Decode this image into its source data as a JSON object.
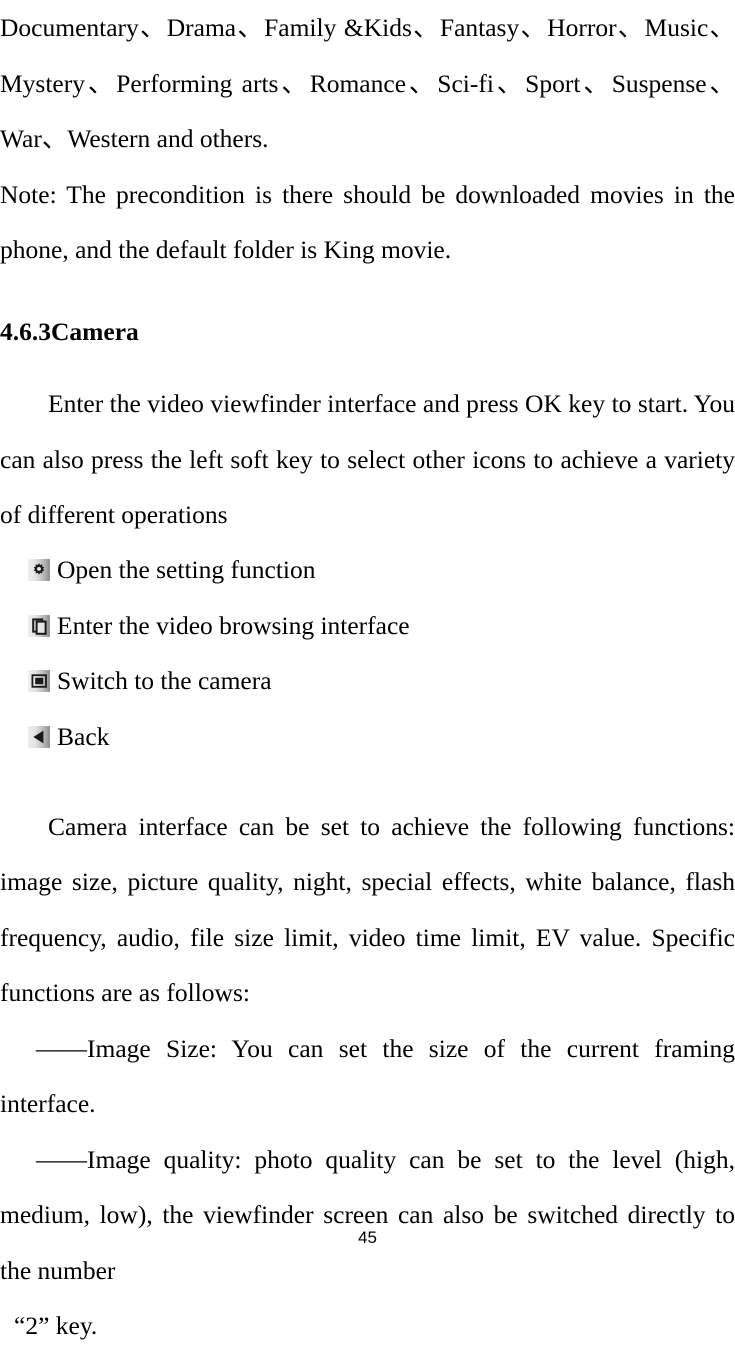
{
  "document": {
    "page_number": "45",
    "paragraphs": {
      "genres_continued": "Documentary、Drama、Family &Kids、Fantasy、Horror、Music、Mystery、Performing arts、Romance、Sci-fi、Sport、Suspense、War、Western and others.",
      "note": "Note: The precondition is there should be downloaded movies in the phone, and the default folder is King movie.",
      "camera_intro": "Enter the video viewfinder interface and press OK key to start. You can also press the left soft key to select other icons to achieve a variety of different operations",
      "camera_functions": "Camera interface can be set to achieve the following functions: image size, picture quality, night, special effects, white balance, flash frequency, audio, file size limit, video time limit, EV value. Specific functions are as follows:"
    },
    "heading": {
      "number_and_title": "4.6.3Camera"
    },
    "icon_list": [
      {
        "icon": "gear-icon",
        "label": "Open the setting function"
      },
      {
        "icon": "gallery-browse-icon",
        "label": "Enter the video browsing interface"
      },
      {
        "icon": "camera-switch-icon",
        "label": "Switch to the camera"
      },
      {
        "icon": "back-arrow-icon",
        "label": "Back"
      }
    ],
    "dash_items": [
      "——Image Size: You can set the size of the current framing interface.",
      "——Image quality: photo quality can be set to the level (high, medium, low), the viewfinder screen can also be switched directly to the number"
    ],
    "trailing_line": "“2” key.",
    "colors": {
      "text": "#000000",
      "background": "#ffffff",
      "icon_gradient_light": "#efefef",
      "icon_gradient_dark": "#8e8e8e",
      "icon_glyph": "#1a1a1a"
    }
  }
}
